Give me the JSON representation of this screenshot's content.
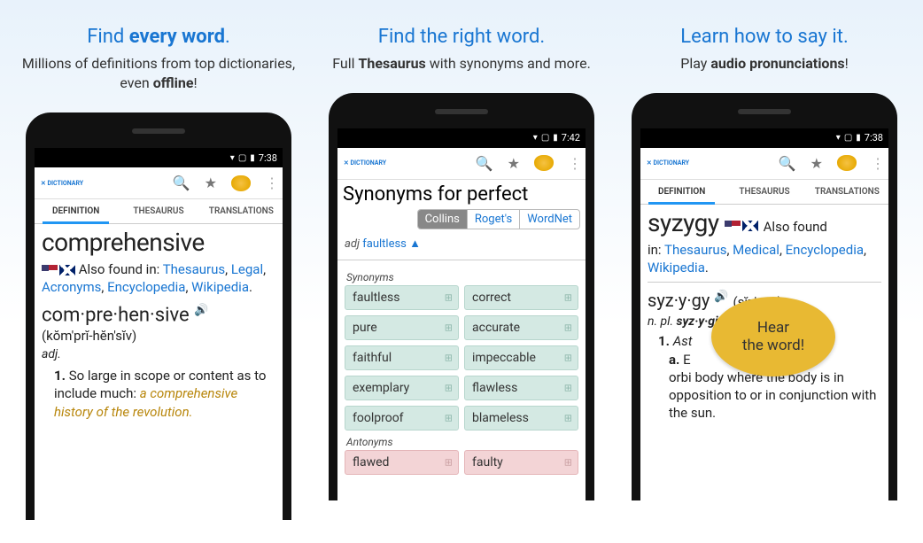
{
  "panels": [
    {
      "headline_pre": "Find ",
      "headline_strong": "every word",
      "headline_post": ".",
      "subhead_pre": "Millions of definitions from top dictionaries, even ",
      "subhead_strong": "offline",
      "subhead_post": "!",
      "statusbar_time": "7:38",
      "tabs": {
        "definition": "DEFINITION",
        "thesaurus": "THESAURUS",
        "translations": "TRANSLATIONS"
      },
      "word": "comprehensive",
      "alsofound_label": "Also found in:",
      "alsofound_links": [
        "Thesaurus",
        "Legal",
        "Acronyms",
        "Encyclopedia",
        "Wikipedia"
      ],
      "syllab": "com·pre·hen·sive",
      "pron": "(kŏm′prĭ-hĕn′sĭv)",
      "pos": "adj.",
      "def_num": "1.",
      "def_text": "So large in scope or content as to include much: ",
      "def_example": "a comprehensive history of the revolution."
    },
    {
      "headline_full": "Find the right word.",
      "subhead_pre": "Full ",
      "subhead_strong": "Thesaurus",
      "subhead_post": " with synonyms and more.",
      "statusbar_time": "7:42",
      "syn_title": "Synonyms for perfect",
      "chips": [
        "Collins",
        "Roget's",
        "WordNet"
      ],
      "sense_adj": "adj",
      "sense_word": "faultless",
      "sense_arrow": "▲",
      "group_syn": "Synonyms",
      "synonyms": [
        "faultless",
        "correct",
        "pure",
        "accurate",
        "faithful",
        "impeccable",
        "exemplary",
        "flawless",
        "foolproof",
        "blameless"
      ],
      "group_ant": "Antonyms",
      "antonyms": [
        "flawed",
        "faulty"
      ]
    },
    {
      "headline_full": "Learn how to say it.",
      "subhead_pre": "Play ",
      "subhead_strong": "audio pronunciations",
      "subhead_post": "!",
      "statusbar_time": "7:38",
      "tabs": {
        "definition": "DEFINITION",
        "thesaurus": "THESAURUS",
        "translations": "TRANSLATIONS"
      },
      "word": "syzygy",
      "alsofound_label": "Also found in:",
      "alsofound_links": [
        "Thesaurus",
        "Medical",
        "Encyclopedia",
        "Wikipedia"
      ],
      "syllab": "syz·y·gy",
      "pron": "(sĭz′ə-jē)",
      "npl_pre": "n. pl. ",
      "npl_strong": "syz·y·gi",
      "def_num": "1.",
      "def_label": "Ast",
      "def_sub_label": "a.",
      "def_text_tail": "body where the body is in opposition to or in conjunction with the sun.",
      "def_frag_orb": "orbi",
      "bubble_line1": "Hear",
      "bubble_line2": "the word!"
    }
  ]
}
